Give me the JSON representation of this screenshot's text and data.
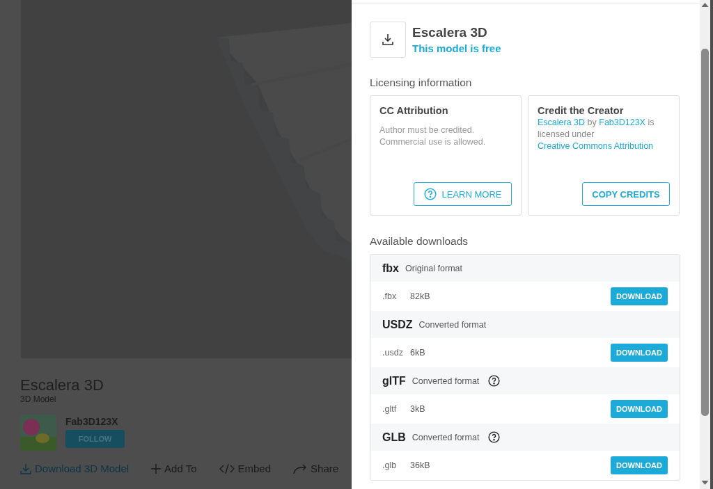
{
  "page": {
    "title": "Escalera 3D",
    "subtitle": "3D Model",
    "author": "Fab3D123X",
    "follow": "FOLLOW",
    "actions": [
      {
        "kind": "download",
        "label": "Download 3D Model"
      },
      {
        "kind": "add",
        "label": "Add To"
      },
      {
        "kind": "embed",
        "label": "Embed"
      },
      {
        "kind": "share",
        "label": "Share"
      }
    ]
  },
  "dialog": {
    "title": "Escalera 3D",
    "price_note": "This model is free",
    "licensing_heading": "Licensing information",
    "license": {
      "title": "CC Attribution",
      "lines": [
        "Author must be credited.",
        "Commercial use is allowed."
      ],
      "button": "LEARN MORE"
    },
    "credit": {
      "title": "Credit the Creator",
      "parts": [
        {
          "kind": "link",
          "text": "Escalera 3D"
        },
        {
          "kind": "plain",
          "text": " by "
        },
        {
          "kind": "link",
          "text": "Fab3D123X"
        },
        {
          "kind": "plain",
          "text": " is licensed under "
        },
        {
          "kind": "link",
          "text": "Creative Commons Attribution"
        }
      ],
      "button": "COPY CREDITS"
    },
    "downloads_heading": "Available downloads",
    "downloads": [
      {
        "format": "fbx",
        "note": "Original format",
        "help": false,
        "ext": ".fbx",
        "size": "82kB",
        "button": "DOWNLOAD"
      },
      {
        "format": "USDZ",
        "note": "Converted format",
        "help": false,
        "ext": ".usdz",
        "size": "6kB",
        "button": "DOWNLOAD"
      },
      {
        "format": "glTF",
        "note": "Converted format",
        "help": true,
        "ext": ".gltf",
        "size": "3kB",
        "button": "DOWNLOAD"
      },
      {
        "format": "GLB",
        "note": "Converted format",
        "help": true,
        "ext": ".glb",
        "size": "36kB",
        "button": "DOWNLOAD"
      }
    ]
  }
}
